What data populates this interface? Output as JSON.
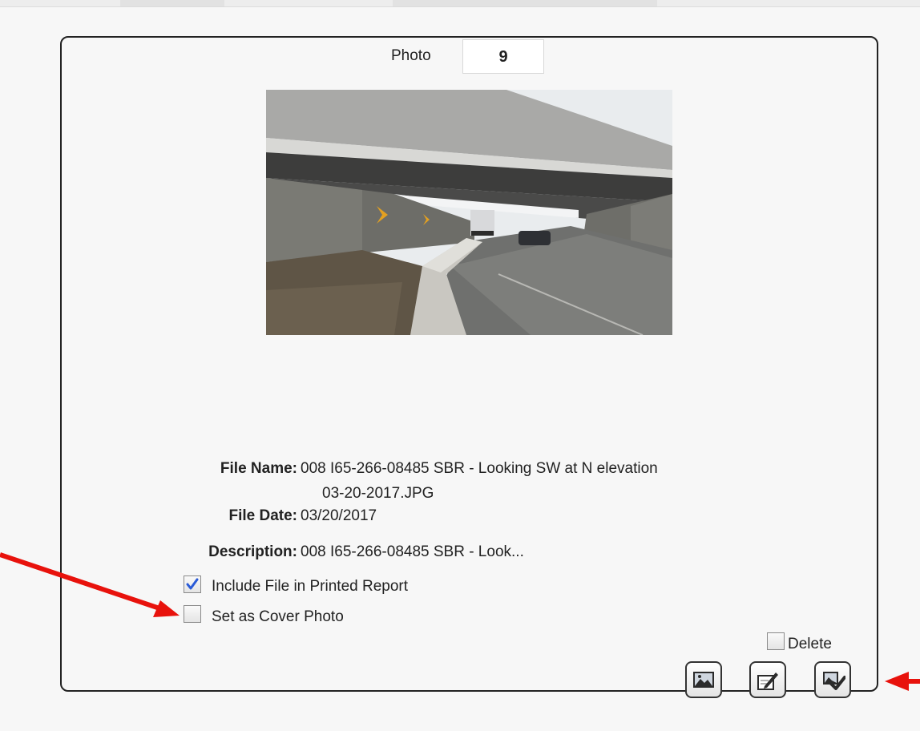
{
  "photo": {
    "label": "Photo",
    "number": "9",
    "image": "overpass-highway-photo"
  },
  "file_info": {
    "file_name_label": "File Name:",
    "file_name_line1": "008 I65-266-08485 SBR - Looking SW at N elevation",
    "file_name_line2": "03-20-2017.JPG",
    "file_date_label": "File Date:",
    "file_date_value": "03/20/2017",
    "description_label": "Description:",
    "description_value": "008 I65-266-08485 SBR - Look..."
  },
  "options": {
    "include_label": "Include File in Printed Report",
    "include_checked": true,
    "cover_label": "Set as Cover Photo",
    "cover_checked": false,
    "delete_label": "Delete",
    "delete_checked": false
  },
  "actions": {
    "icons": [
      "view-image-icon",
      "edit-icon",
      "approve-icon"
    ]
  },
  "colors": {
    "annotation_arrow": "#e8120c",
    "checkbox_tick": "#2a5bd7"
  }
}
